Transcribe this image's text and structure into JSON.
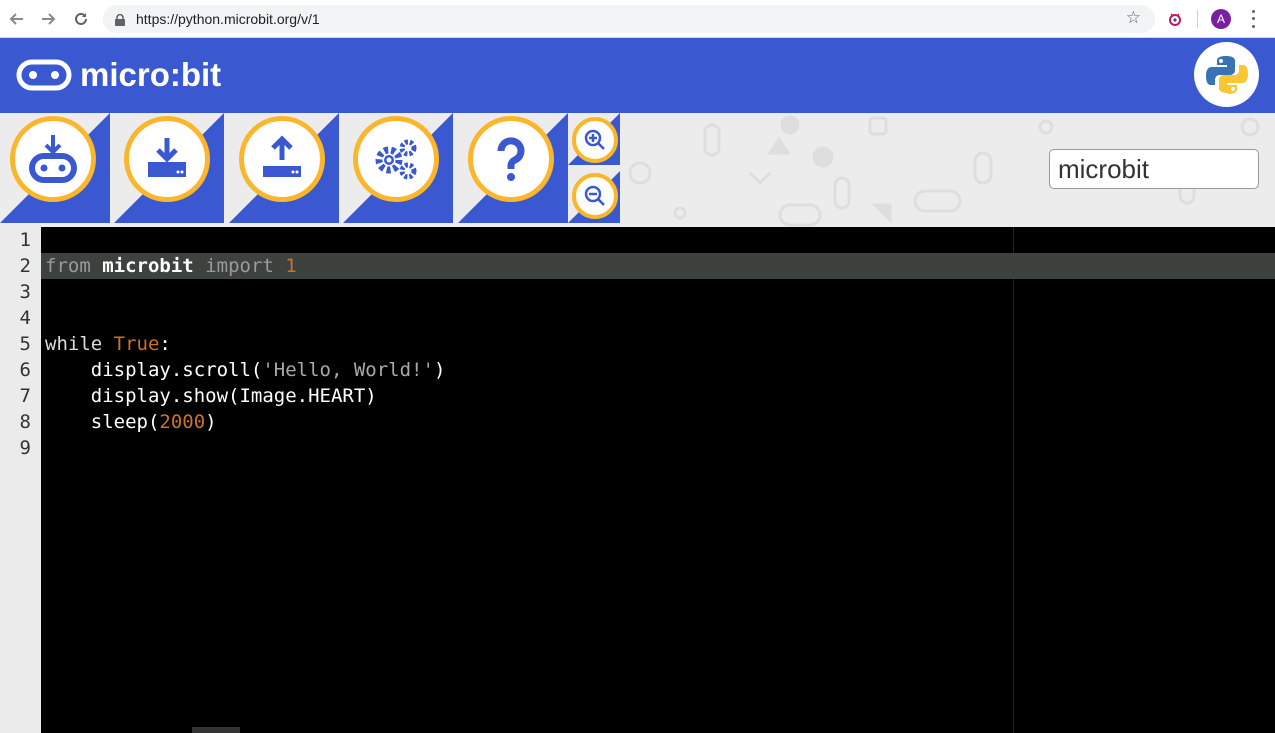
{
  "browser": {
    "url": "https://python.microbit.org/v/1",
    "avatar_letter": "A"
  },
  "header": {
    "logo_text": "micro:bit",
    "brand_color": "#3a58d0",
    "accent_color": "#fbb62c"
  },
  "toolbar": {
    "download_label": "Download",
    "save_label": "Save",
    "load_label": "Load",
    "snippets_label": "Snippets",
    "help_label": "Help",
    "script_name": "microbit"
  },
  "editor": {
    "line_numbers": [
      "1",
      "2",
      "3",
      "4",
      "5",
      "6",
      "7",
      "8",
      "9"
    ],
    "active_line": 2,
    "line2": {
      "kw1": "from",
      "mod": "microbit",
      "kw2": "import",
      "num": "1"
    },
    "line5": {
      "kw": "while",
      "val": "True",
      "colon": ":"
    },
    "line6": {
      "pre": "    display.scroll(",
      "str": "'Hello, World!'",
      "post": ")"
    },
    "line7": {
      "text": "    display.show(Image.HEART)"
    },
    "line8": {
      "pre": "    sleep(",
      "num": "2000",
      "post": ")"
    }
  }
}
